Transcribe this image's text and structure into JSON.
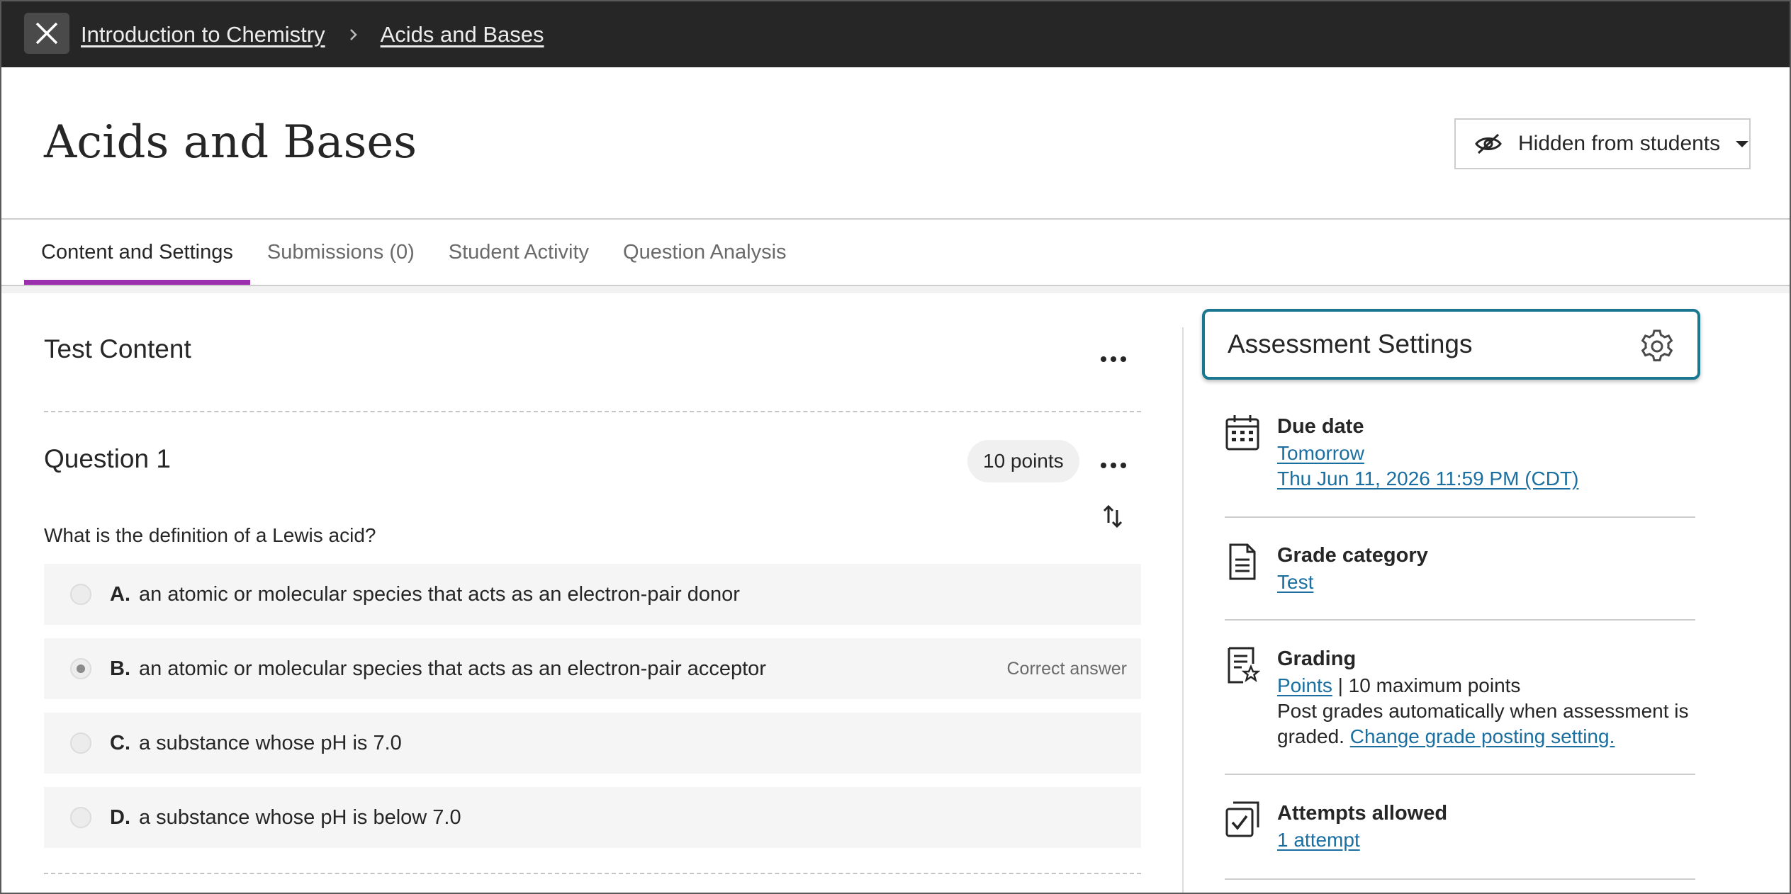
{
  "breadcrumb": {
    "course": "Introduction to Chemistry",
    "current": "Acids and Bases"
  },
  "header": {
    "title": "Acids and Bases",
    "visibility_label": "Hidden from students"
  },
  "tabs": [
    {
      "label": "Content and Settings",
      "active": true
    },
    {
      "label": "Submissions (0)",
      "active": false
    },
    {
      "label": "Student Activity",
      "active": false
    },
    {
      "label": "Question Analysis",
      "active": false
    }
  ],
  "content": {
    "section_title": "Test Content",
    "question": {
      "title": "Question 1",
      "points": "10 points",
      "text": "What is the definition of a Lewis acid?",
      "answers": [
        {
          "letter": "A.",
          "text": "an atomic or molecular species that acts as an electron-pair donor",
          "note": ""
        },
        {
          "letter": "B.",
          "text": "an atomic or molecular species that acts as an electron-pair acceptor",
          "note": "Correct answer"
        },
        {
          "letter": "C.",
          "text": "a substance whose pH is 7.0",
          "note": ""
        },
        {
          "letter": "D.",
          "text": "a substance whose pH is below 7.0",
          "note": ""
        }
      ]
    }
  },
  "settings": {
    "title": "Assessment Settings",
    "due_date": {
      "label": "Due date",
      "relative": "Tomorrow",
      "absolute": "Thu Jun 11, 2026 11:59 PM (CDT)"
    },
    "grade_category": {
      "label": "Grade category",
      "value": "Test"
    },
    "grading": {
      "label": "Grading",
      "schema": "Points",
      "max": " | 10 maximum points",
      "post_text": "Post grades automatically when assessment is graded.",
      "change_link": "Change grade posting setting."
    },
    "attempts": {
      "label": "Attempts allowed",
      "value": "1 attempt"
    }
  },
  "colors": {
    "accent_tab": "#9b2fae",
    "focus_ring": "#1b7690",
    "link": "#1b6fa0",
    "topbar": "#262626"
  },
  "icons": [
    "close-icon",
    "chevron-right-icon",
    "eye-slash-icon",
    "caret-down-icon",
    "more-options-icon",
    "reorder-icon",
    "gear-icon",
    "calendar-icon",
    "document-icon",
    "grading-icon",
    "attempts-icon"
  ]
}
